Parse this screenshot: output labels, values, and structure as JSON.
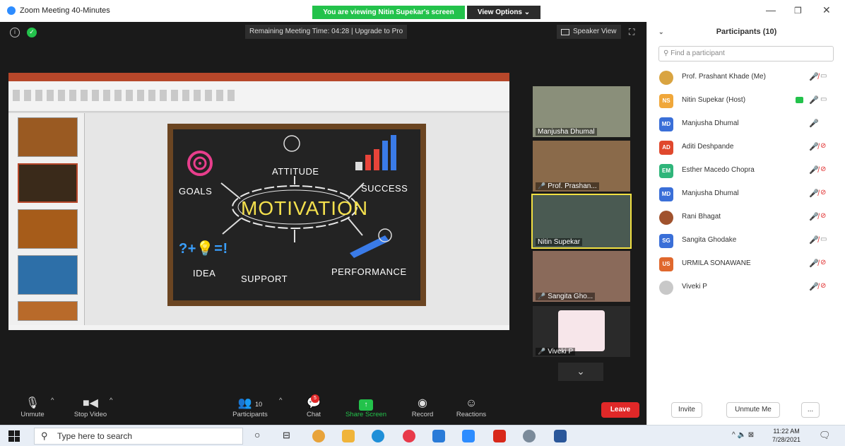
{
  "window": {
    "title": "Zoom Meeting 40-Minutes",
    "viewing_banner": "You are viewing Nitin Supekar's screen",
    "view_options": "View Options ⌄"
  },
  "meeting": {
    "remaining_time": "Remaining Meeting Time: 04:28 | Upgrade to Pro",
    "speaker_view": "Speaker View"
  },
  "slide": {
    "center": "MOTIVATION",
    "labels": [
      "ATTITUDE",
      "GOALS",
      "SUCCESS",
      "IDEA",
      "SUPPORT",
      "PERFORMANCE"
    ],
    "idea_formula": "?+💡=!"
  },
  "videos": [
    {
      "name": "Manjusha Dhumal",
      "muted": false
    },
    {
      "name": "Prof. Prashan...",
      "muted": true
    },
    {
      "name": "Nitin Supekar",
      "muted": false
    },
    {
      "name": "Sangita Gho...",
      "muted": true
    },
    {
      "name": "Viveki P",
      "muted": true
    }
  ],
  "toolbar": {
    "unmute": "Unmute",
    "stop_video": "Stop Video",
    "participants": "Participants",
    "participants_count": "10",
    "chat": "Chat",
    "chat_badge": "5",
    "share_screen": "Share Screen",
    "record": "Record",
    "reactions": "Reactions",
    "leave": "Leave"
  },
  "panel": {
    "title": "Participants (10)",
    "search_placeholder": "Find a participant",
    "participants": [
      {
        "initials": "",
        "name": "Prof. Prashant Khade (Me)",
        "color": "#d9a441",
        "photo": true,
        "mic": "off",
        "cam": "on"
      },
      {
        "initials": "NS",
        "name": "Nitin Supekar (Host)",
        "color": "#f0a73a",
        "photo": false,
        "mic": "on",
        "cam": "on",
        "sharing": true
      },
      {
        "initials": "MD",
        "name": "Manjusha Dhumal",
        "color": "#3a6fd8",
        "photo": false,
        "mic": "on",
        "cam": "none"
      },
      {
        "initials": "AD",
        "name": "Aditi Deshpande",
        "color": "#e0482d",
        "photo": false,
        "mic": "off",
        "cam": "off"
      },
      {
        "initials": "EM",
        "name": "Esther Macedo Chopra",
        "color": "#2fb57a",
        "photo": false,
        "mic": "off",
        "cam": "off"
      },
      {
        "initials": "MD",
        "name": "Manjusha Dhumal",
        "color": "#3a6fd8",
        "photo": false,
        "mic": "off",
        "cam": "off"
      },
      {
        "initials": "",
        "name": "Rani Bhagat",
        "color": "#a0522d",
        "photo": true,
        "mic": "off",
        "cam": "off"
      },
      {
        "initials": "SG",
        "name": "Sangita Ghodake",
        "color": "#3a6fd8",
        "photo": false,
        "mic": "off",
        "cam": "on"
      },
      {
        "initials": "US",
        "name": "URMILA SONAWANE",
        "color": "#e0682d",
        "photo": false,
        "mic": "off",
        "cam": "off"
      },
      {
        "initials": "",
        "name": "Viveki P",
        "color": "#c8c8c8",
        "photo": true,
        "mic": "off",
        "cam": "off"
      }
    ],
    "invite": "Invite",
    "unmute_me": "Unmute Me",
    "more": "..."
  },
  "taskbar": {
    "search_placeholder": "Type here to search",
    "time": "11:22 AM",
    "date": "7/28/2021"
  },
  "colors": {
    "zoom_blue": "#2d8cff",
    "green": "#23c24b",
    "leave_red": "#e02828",
    "meeting_bg": "#1a1a1a"
  }
}
